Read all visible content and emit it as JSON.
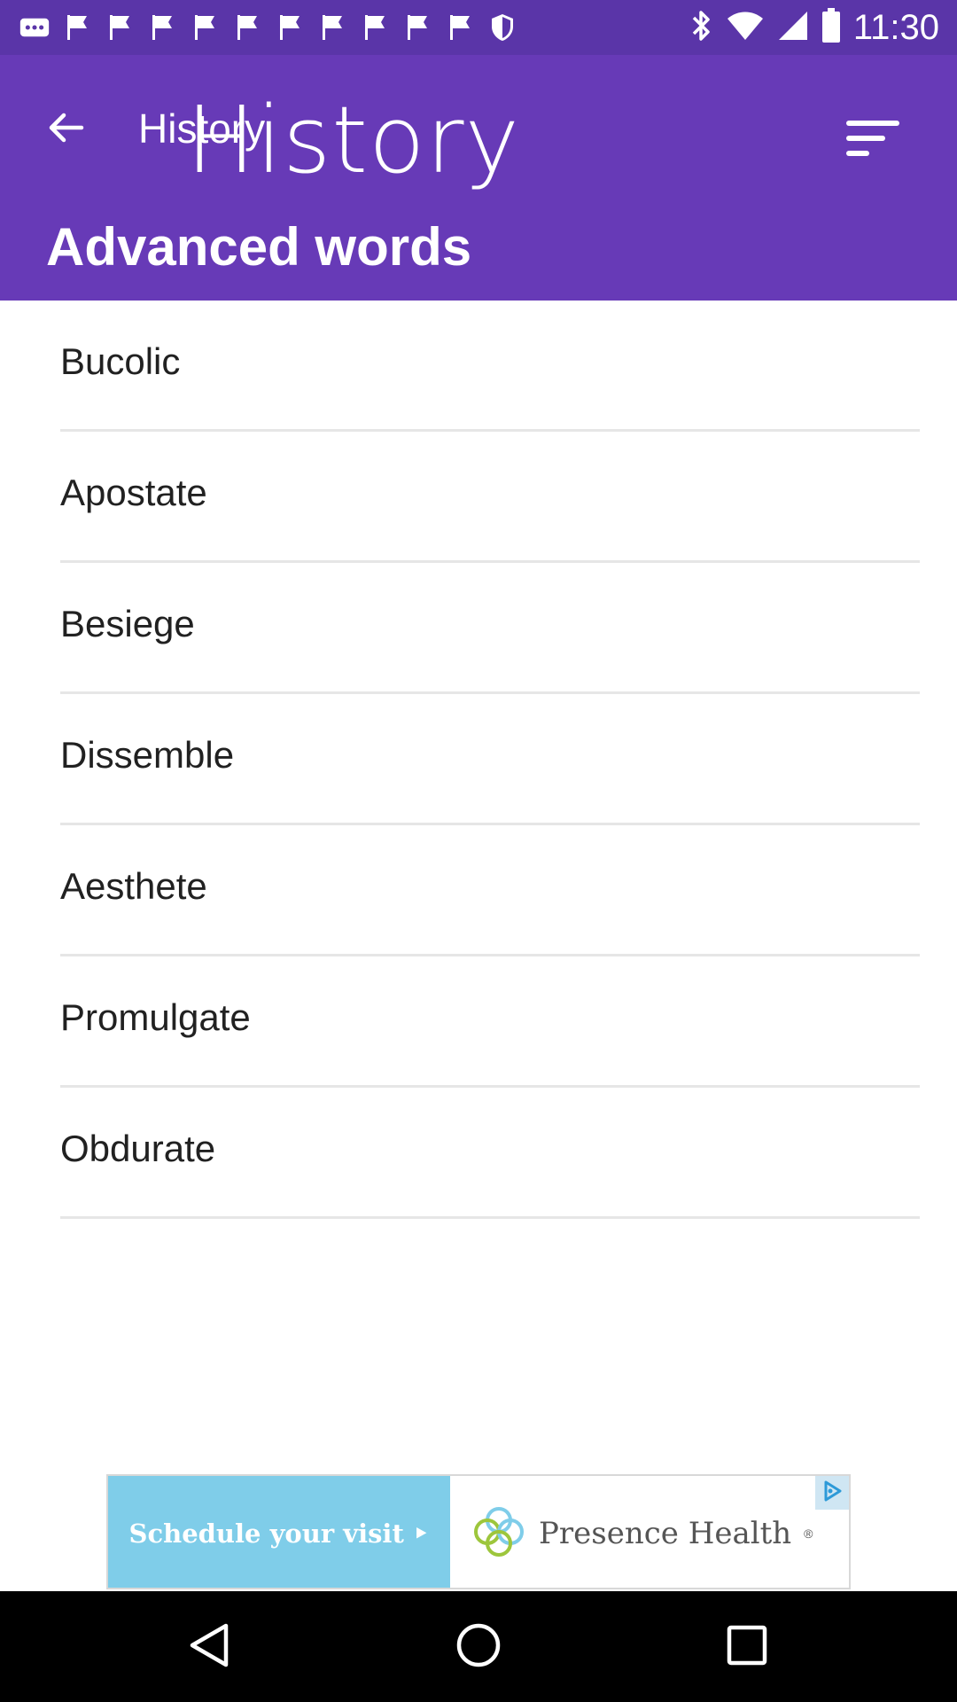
{
  "status_bar": {
    "time": "11:30",
    "left_icons": [
      "more-dots-icon",
      "flag-icon",
      "flag-icon",
      "flag-icon",
      "flag-icon",
      "flag-icon",
      "flag-icon",
      "flag-icon",
      "flag-icon",
      "flag-icon",
      "flag-icon",
      "shield-icon"
    ],
    "right_icons": [
      "bluetooth-icon",
      "wifi-icon",
      "signal-icon",
      "battery-icon"
    ]
  },
  "app_bar": {
    "title": "History",
    "logo_text": "History",
    "subtitle": "Advanced words",
    "back_icon": "arrow-back-icon",
    "sort_icon": "sort-icon"
  },
  "words": [
    {
      "label": "Bucolic"
    },
    {
      "label": "Apostate"
    },
    {
      "label": "Besiege"
    },
    {
      "label": "Dissemble"
    },
    {
      "label": "Aesthete"
    },
    {
      "label": "Promulgate"
    },
    {
      "label": "Obdurate"
    }
  ],
  "ad": {
    "cta": "Schedule your visit ‣",
    "brand": "Presence Health",
    "brand_mark": "®",
    "choice_icon": "adchoices-icon"
  },
  "nav_bar": {
    "icons": [
      "back-triangle-icon",
      "home-circle-icon",
      "recents-square-icon"
    ]
  },
  "colors": {
    "status_bar": "#5a35a8",
    "app_bar": "#673ab7",
    "divider": "#e6e6e6",
    "ad_cta": "#7fcde9"
  }
}
